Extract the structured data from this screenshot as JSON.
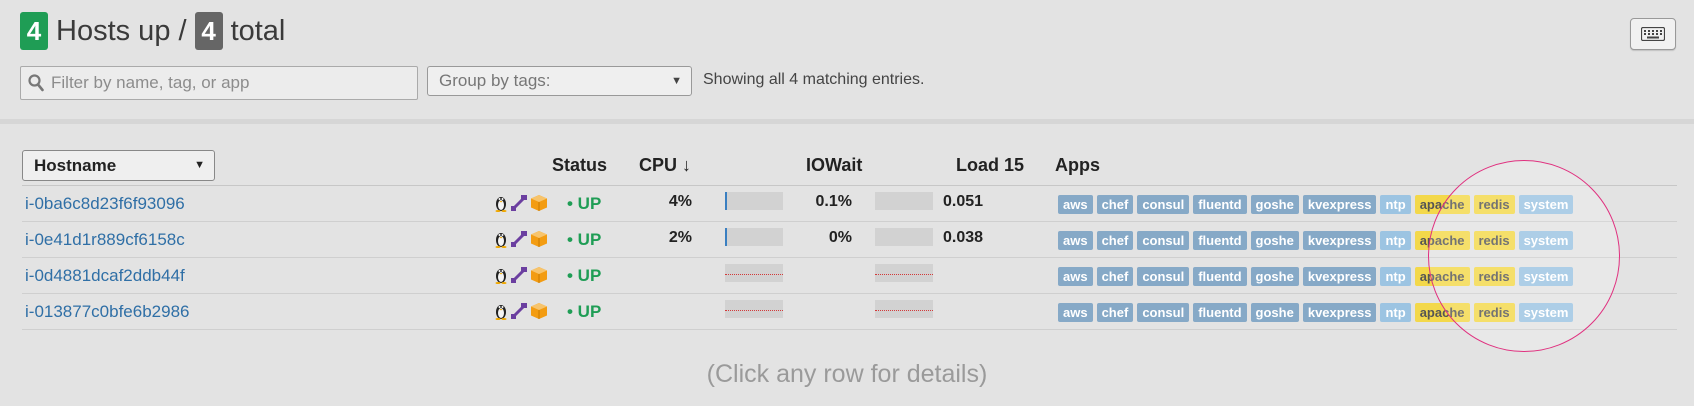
{
  "header": {
    "up_count": "4",
    "up_label": "Hosts up /",
    "total_count": "4",
    "total_label": "total"
  },
  "filter": {
    "placeholder": "Filter by name, tag, or app"
  },
  "groupby": {
    "label": "Group by tags:"
  },
  "showing": "Showing all 4 matching entries.",
  "table": {
    "columns": {
      "hostname": "Hostname",
      "status": "Status",
      "cpu": "CPU ↓",
      "iowait": "IOWait",
      "load": "Load 15",
      "apps": "Apps"
    },
    "rows": [
      {
        "hostname": "i-0ba6c8d23f6f93096",
        "status": "• UP",
        "cpu": "4%",
        "cpu_fraction": 0.04,
        "iowait": "0.1%",
        "iowait_fraction": 0.001,
        "load": "0.051"
      },
      {
        "hostname": "i-0e41d1r889cf6158c",
        "status": "• UP",
        "cpu": "2%",
        "cpu_fraction": 0.02,
        "iowait": "0%",
        "iowait_fraction": 0,
        "load": "0.038"
      },
      {
        "hostname": "i-0d4881dcaf2ddb44f",
        "status": "• UP",
        "cpu": "",
        "iowait": "",
        "load": ""
      },
      {
        "hostname": "i-013877c0bfe6b2986",
        "status": "• UP",
        "cpu": "",
        "iowait": "",
        "load": ""
      }
    ],
    "row_icons": [
      "linux-penguin-icon",
      "puppet-icon",
      "aws-box-icon"
    ],
    "apps": [
      "aws",
      "chef",
      "consul",
      "fluentd",
      "goshe",
      "kvexpress",
      "ntp",
      "apache",
      "redis",
      "system"
    ]
  },
  "hint": "(Click any row for details)",
  "colors": {
    "up_badge": "#1f9d55",
    "total_badge": "#666666",
    "link": "#2f6fa6",
    "tag_blue": "#86a9c7",
    "tag_yellow": "#f3d84a",
    "highlight_circle": "#e0307f"
  }
}
